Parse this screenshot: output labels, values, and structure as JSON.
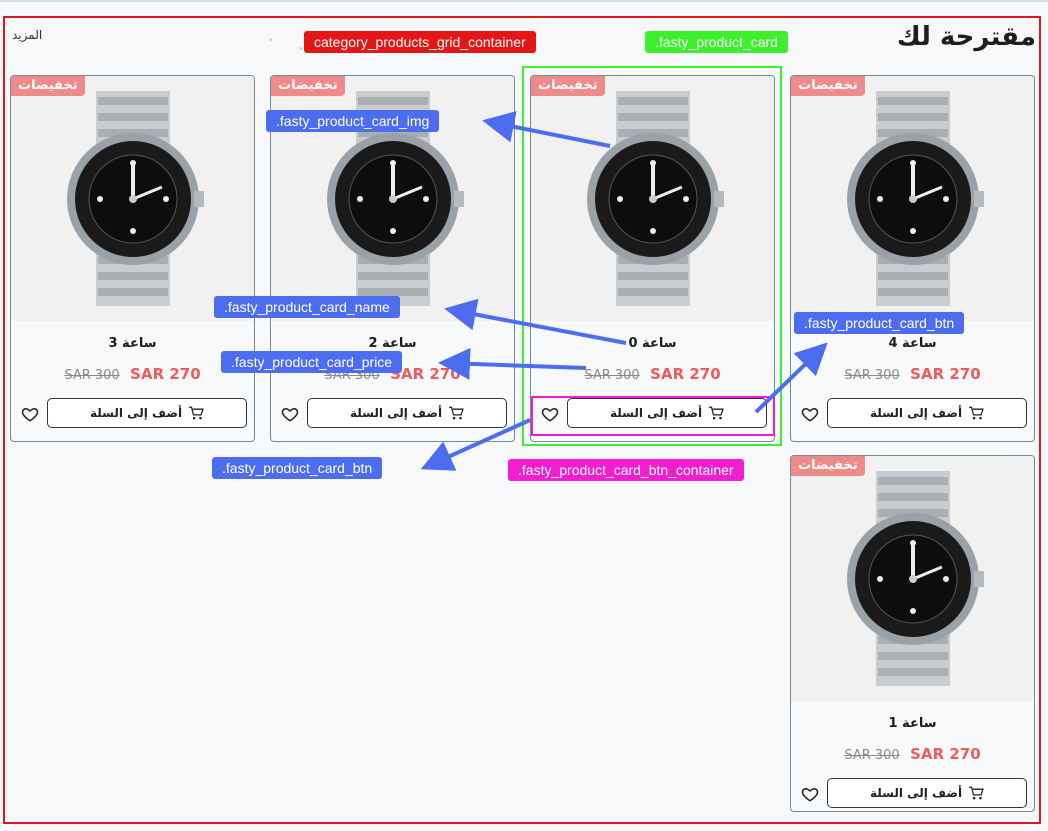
{
  "section": {
    "title": "مقترحة لك",
    "more": "المزيد"
  },
  "products": [
    {
      "badge": "تخفيضات",
      "name": "ساعة 4",
      "old_price": "SAR 300",
      "new_price": "SAR 270",
      "add_label": "أضف إلى السلة"
    },
    {
      "badge": "تخفيضات",
      "name": "ساعة 0",
      "old_price": "SAR 300",
      "new_price": "SAR 270",
      "add_label": "أضف إلى السلة"
    },
    {
      "badge": "تخفيضات",
      "name": "ساعة 2",
      "old_price": "SAR 300",
      "new_price": "SAR 270",
      "add_label": "أضف إلى السلة"
    },
    {
      "badge": "تخفيضات",
      "name": "ساعة 3",
      "old_price": "SAR 300",
      "new_price": "SAR 270",
      "add_label": "أضف إلى السلة"
    },
    {
      "badge": "تخفيضات",
      "name": "ساعة 1",
      "old_price": "SAR 300",
      "new_price": "SAR 270",
      "add_label": "أضف إلى السلة"
    }
  ],
  "annotations": {
    "grid": "category_products_grid_container",
    "card": ".fasty_product_card",
    "img": ".fasty_product_card_img",
    "name": ".fasty_product_card_name",
    "price": ".fasty_product_card_price",
    "btn_right": ".fasty_product_card_btn",
    "btn_left": ".fasty_product_card_btn",
    "btn_container": ".fasty_product_card_btn_container"
  },
  "colors": {
    "sale_badge": "#ef8a8a",
    "new_price": "#ef5a5a",
    "grid_outline": "#e0161b",
    "card_outline": "#3cf02c",
    "btn_container_outline": "#f01ecf",
    "annotation_blue": "#4d6df0"
  }
}
